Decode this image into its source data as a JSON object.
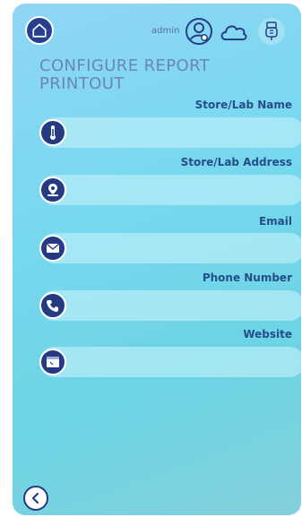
{
  "header": {
    "user_name": "admin",
    "icons": [
      "home-icon",
      "user-settings-icon",
      "cloud-icon",
      "usb-icon"
    ]
  },
  "page": {
    "title": "CONFIGURE REPORT PRINTOUT"
  },
  "fields": [
    {
      "label": "Store/Lab Name",
      "icon": "thermometer-icon",
      "value": ""
    },
    {
      "label": "Store/Lab Address",
      "icon": "location-pin-icon",
      "value": ""
    },
    {
      "label": "Email",
      "icon": "envelope-icon",
      "value": ""
    },
    {
      "label": "Phone Number",
      "icon": "phone-icon",
      "value": ""
    },
    {
      "label": "Website",
      "icon": "browser-window-icon",
      "value": ""
    }
  ],
  "footer": {
    "back_icon": "chevron-left-icon"
  },
  "colors": {
    "accent": "#243b84",
    "label": "#244d8a",
    "title": "#6a86b6"
  }
}
